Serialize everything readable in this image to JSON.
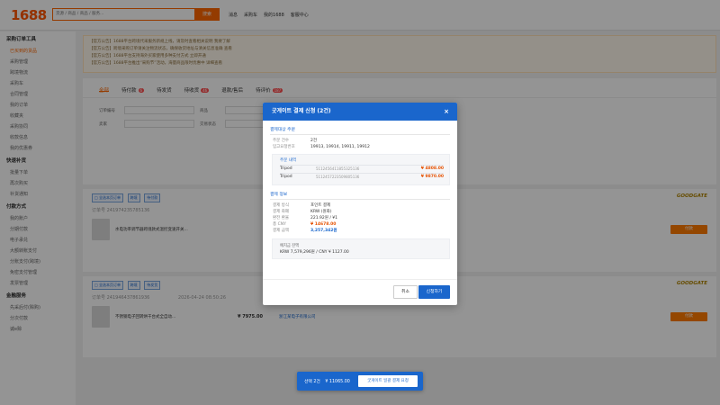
{
  "app": {
    "logo": "1688",
    "search_placeholder": "货源 / 商品 / 商品 / 服务...",
    "search_button": "搜索",
    "nav": [
      "消息",
      "采购车",
      "我的1688",
      "客服中心"
    ]
  },
  "sidebar": {
    "groups": [
      {
        "title": "采购订单工具",
        "items": [
          "已买到的货品",
          "采购管理",
          "跨境物流",
          "采购车",
          "合同管理",
          "我的订单",
          "收藏夹",
          "采购协同",
          "收款信息",
          "我的优惠券"
        ]
      },
      {
        "title": "快速补货",
        "items": [
          "批量下单",
          "再次购买",
          "补货通知"
        ]
      },
      {
        "title": "付款方式",
        "items": [
          "我的账户",
          "分期付款",
          "电子承兑",
          "大额转账支付",
          "分账支付(跨境)",
          "免密支付管理",
          "发票管理"
        ]
      },
      {
        "title": "金融服务",
        "items": [
          "先采后付(赊购)",
          "分次付款",
          "诚e赊"
        ]
      }
    ]
  },
  "notices": [
    "【官方公告】1688平台跨境代采服务新规上线，请及时查看相关说明 我要了解",
    "【官方公告】跨境采购订单请关注物流状态，确保收货地址与清关信息准确 查看",
    "【官方公告】1688平台支持海外买家使用多种支付方式 立即开通",
    "【官方公告】1688平台推出“采购节”活动，海量商品限时优惠中 详细查看"
  ],
  "tabs": [
    {
      "label": "全部",
      "badge": ""
    },
    {
      "label": "待付款",
      "badge": "6"
    },
    {
      "label": "待发货",
      "badge": ""
    },
    {
      "label": "待收货",
      "badge": "46"
    },
    {
      "label": "退款/售后",
      "badge": ""
    },
    {
      "label": "待评价",
      "badge": "187"
    }
  ],
  "filters": {
    "labels": [
      "订单编号",
      "商品",
      "卖家",
      "交易状态"
    ],
    "export_button": "导出",
    "search_button": "搜索"
  },
  "orders": [
    {
      "chips": [
        "□ 全选本页订单",
        "跨境",
        "待付款"
      ],
      "brand": "GOODGATE",
      "order_no": "订单号 241974235785136",
      "title": "水电功率调节器跨境款式温控变速开关...",
      "price": "",
      "action": "付款"
    },
    {
      "chips": [
        "□ 全选本页订单",
        "跨境",
        "待发货"
      ],
      "brand": "GOODGATE",
      "order_no": "订单号 241946437861936",
      "time": "2026-04-24 08:50:26",
      "title": "不锈钢电子回转烘干台式全自动...",
      "price": "¥ 7975.00",
      "seller": "浙江某电子有限公司",
      "action": "付款"
    }
  ],
  "float_bar": {
    "label": "선택 2건",
    "amount": "¥ 11065.00",
    "button": "굿게이트 일괄 결제 요청"
  },
  "modal": {
    "title": "굿게이트 결제 신청 (2건)",
    "close": "×",
    "section_target": "결제대상 주문",
    "order_count_label": "주문 건수",
    "order_count_value": "2건",
    "order_nos_label": "입고요청번호",
    "order_nos_value": "19913, 19914, 19911, 19912",
    "items_header": "주문 내역",
    "items": [
      {
        "name": "Tripod",
        "id": "5112456411855325136",
        "price": "¥ 4808.00"
      },
      {
        "name": "Tripod",
        "id": "5112457223509805136",
        "price": "¥ 9870.00"
      }
    ],
    "section_payment": "결제 정보",
    "payment": [
      {
        "k": "결제 방식",
        "v": "포인트 결제"
      },
      {
        "k": "결제 화폐",
        "v": "KRW (원화)"
      },
      {
        "k": "환전 환율",
        "v": "221.92원 / ¥1"
      },
      {
        "k": "총 CNY",
        "v": "¥ 14678.00"
      },
      {
        "k": "결제 금액",
        "v": "3,257,342원"
      }
    ],
    "rate_title": "예치금 잔액",
    "rate_value": "KRW 7,579,296원 / CNY ¥ 1127.00",
    "cancel": "취소",
    "confirm": "신청하기"
  },
  "colors": {
    "brand_orange": "#ff6600",
    "modal_blue": "#1a66cc",
    "price_red": "#e65100"
  }
}
